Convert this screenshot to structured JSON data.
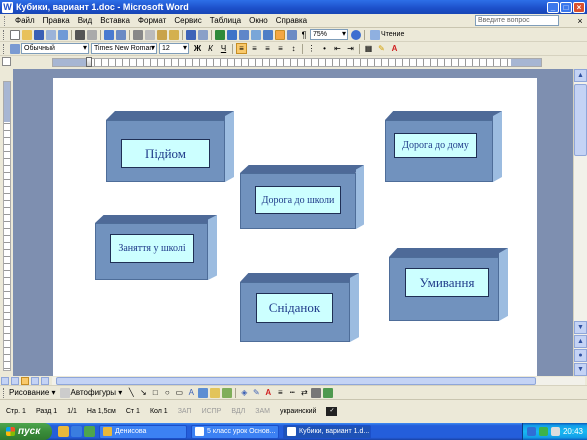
{
  "window": {
    "title": "Кубики, вариант 1.doc - Microsoft Word",
    "app_icon": "W",
    "minimize": "_",
    "maximize": "□",
    "close": "×"
  },
  "menu": {
    "items": [
      "Файл",
      "Правка",
      "Вид",
      "Вставка",
      "Формат",
      "Сервис",
      "Таблица",
      "Окно",
      "Справка"
    ],
    "help_placeholder": "Введите вопрос",
    "close_doc": "×"
  },
  "standard_toolbar": {
    "zoom": "75%",
    "read_label": "Чтение"
  },
  "formatting_toolbar": {
    "style": "Обычный",
    "font": "Times New Roman",
    "size": "12",
    "bold": "Ж",
    "italic": "К",
    "underline": "Ч"
  },
  "document": {
    "blocks": [
      {
        "id": "pidiom",
        "text": "Підйом"
      },
      {
        "id": "doroha-do-domu",
        "text": "Дорога до дому"
      },
      {
        "id": "doroha-do-shkoly",
        "text": "Дорога до школи"
      },
      {
        "id": "zaniattia",
        "text": "Заняття у школі"
      },
      {
        "id": "snidanok",
        "text": "Сніданок"
      },
      {
        "id": "umyvannia",
        "text": "Умивання"
      }
    ]
  },
  "draw_toolbar": {
    "drawing_label": "Рисование",
    "autoshapes_label": "Автофигуры"
  },
  "status_bar": {
    "page": "Стр. 1",
    "section": "Разд 1",
    "pages": "1/1",
    "at": "На 1,5см",
    "line": "Ст 1",
    "col": "Кол 1",
    "rec": "ЗАП",
    "trk": "ИСПР",
    "ext": "ВДЛ",
    "ovr": "ЗАМ",
    "language": "украинский"
  },
  "taskbar": {
    "start_label": "пуск",
    "tasks": [
      {
        "label": "Денисова",
        "active": false
      },
      {
        "label": "5 класс урок Основ...",
        "active": false
      },
      {
        "label": "Кубики, вариант 1.d...",
        "active": true
      }
    ],
    "clock": "20:43"
  },
  "colors": {
    "box_front": "#7192be",
    "box_top": "#4e6a98",
    "box_side": "#9cbce0",
    "label_fill": "#ccffff",
    "label_text": "#1f3b8a"
  }
}
